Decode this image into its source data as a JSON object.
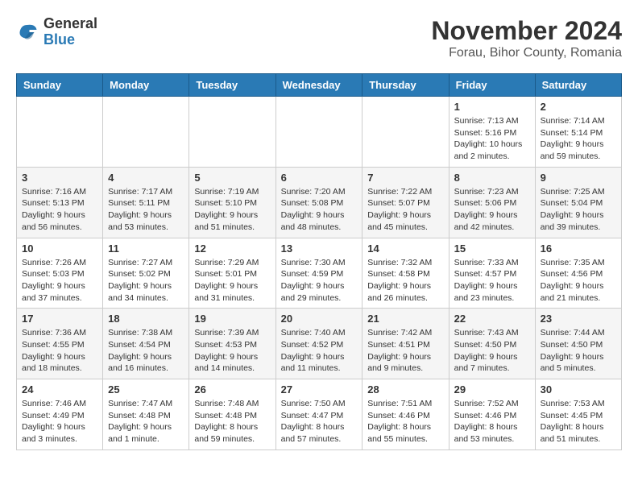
{
  "header": {
    "logo_general": "General",
    "logo_blue": "Blue",
    "month_title": "November 2024",
    "location": "Forau, Bihor County, Romania"
  },
  "weekdays": [
    "Sunday",
    "Monday",
    "Tuesday",
    "Wednesday",
    "Thursday",
    "Friday",
    "Saturday"
  ],
  "weeks": [
    [
      {
        "day": "",
        "info": ""
      },
      {
        "day": "",
        "info": ""
      },
      {
        "day": "",
        "info": ""
      },
      {
        "day": "",
        "info": ""
      },
      {
        "day": "",
        "info": ""
      },
      {
        "day": "1",
        "info": "Sunrise: 7:13 AM\nSunset: 5:16 PM\nDaylight: 10 hours and 2 minutes."
      },
      {
        "day": "2",
        "info": "Sunrise: 7:14 AM\nSunset: 5:14 PM\nDaylight: 9 hours and 59 minutes."
      }
    ],
    [
      {
        "day": "3",
        "info": "Sunrise: 7:16 AM\nSunset: 5:13 PM\nDaylight: 9 hours and 56 minutes."
      },
      {
        "day": "4",
        "info": "Sunrise: 7:17 AM\nSunset: 5:11 PM\nDaylight: 9 hours and 53 minutes."
      },
      {
        "day": "5",
        "info": "Sunrise: 7:19 AM\nSunset: 5:10 PM\nDaylight: 9 hours and 51 minutes."
      },
      {
        "day": "6",
        "info": "Sunrise: 7:20 AM\nSunset: 5:08 PM\nDaylight: 9 hours and 48 minutes."
      },
      {
        "day": "7",
        "info": "Sunrise: 7:22 AM\nSunset: 5:07 PM\nDaylight: 9 hours and 45 minutes."
      },
      {
        "day": "8",
        "info": "Sunrise: 7:23 AM\nSunset: 5:06 PM\nDaylight: 9 hours and 42 minutes."
      },
      {
        "day": "9",
        "info": "Sunrise: 7:25 AM\nSunset: 5:04 PM\nDaylight: 9 hours and 39 minutes."
      }
    ],
    [
      {
        "day": "10",
        "info": "Sunrise: 7:26 AM\nSunset: 5:03 PM\nDaylight: 9 hours and 37 minutes."
      },
      {
        "day": "11",
        "info": "Sunrise: 7:27 AM\nSunset: 5:02 PM\nDaylight: 9 hours and 34 minutes."
      },
      {
        "day": "12",
        "info": "Sunrise: 7:29 AM\nSunset: 5:01 PM\nDaylight: 9 hours and 31 minutes."
      },
      {
        "day": "13",
        "info": "Sunrise: 7:30 AM\nSunset: 4:59 PM\nDaylight: 9 hours and 29 minutes."
      },
      {
        "day": "14",
        "info": "Sunrise: 7:32 AM\nSunset: 4:58 PM\nDaylight: 9 hours and 26 minutes."
      },
      {
        "day": "15",
        "info": "Sunrise: 7:33 AM\nSunset: 4:57 PM\nDaylight: 9 hours and 23 minutes."
      },
      {
        "day": "16",
        "info": "Sunrise: 7:35 AM\nSunset: 4:56 PM\nDaylight: 9 hours and 21 minutes."
      }
    ],
    [
      {
        "day": "17",
        "info": "Sunrise: 7:36 AM\nSunset: 4:55 PM\nDaylight: 9 hours and 18 minutes."
      },
      {
        "day": "18",
        "info": "Sunrise: 7:38 AM\nSunset: 4:54 PM\nDaylight: 9 hours and 16 minutes."
      },
      {
        "day": "19",
        "info": "Sunrise: 7:39 AM\nSunset: 4:53 PM\nDaylight: 9 hours and 14 minutes."
      },
      {
        "day": "20",
        "info": "Sunrise: 7:40 AM\nSunset: 4:52 PM\nDaylight: 9 hours and 11 minutes."
      },
      {
        "day": "21",
        "info": "Sunrise: 7:42 AM\nSunset: 4:51 PM\nDaylight: 9 hours and 9 minutes."
      },
      {
        "day": "22",
        "info": "Sunrise: 7:43 AM\nSunset: 4:50 PM\nDaylight: 9 hours and 7 minutes."
      },
      {
        "day": "23",
        "info": "Sunrise: 7:44 AM\nSunset: 4:50 PM\nDaylight: 9 hours and 5 minutes."
      }
    ],
    [
      {
        "day": "24",
        "info": "Sunrise: 7:46 AM\nSunset: 4:49 PM\nDaylight: 9 hours and 3 minutes."
      },
      {
        "day": "25",
        "info": "Sunrise: 7:47 AM\nSunset: 4:48 PM\nDaylight: 9 hours and 1 minute."
      },
      {
        "day": "26",
        "info": "Sunrise: 7:48 AM\nSunset: 4:48 PM\nDaylight: 8 hours and 59 minutes."
      },
      {
        "day": "27",
        "info": "Sunrise: 7:50 AM\nSunset: 4:47 PM\nDaylight: 8 hours and 57 minutes."
      },
      {
        "day": "28",
        "info": "Sunrise: 7:51 AM\nSunset: 4:46 PM\nDaylight: 8 hours and 55 minutes."
      },
      {
        "day": "29",
        "info": "Sunrise: 7:52 AM\nSunset: 4:46 PM\nDaylight: 8 hours and 53 minutes."
      },
      {
        "day": "30",
        "info": "Sunrise: 7:53 AM\nSunset: 4:45 PM\nDaylight: 8 hours and 51 minutes."
      }
    ]
  ]
}
